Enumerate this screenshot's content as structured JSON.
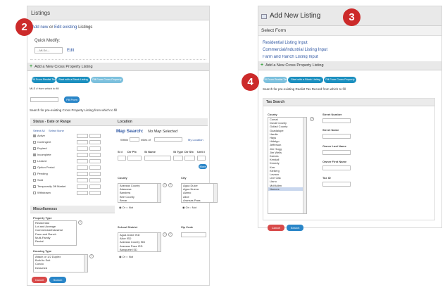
{
  "left": {
    "header": "Listings",
    "add_new": "Add new",
    "or": "or",
    "edit_existing": "Edit existing",
    "listings": "Listings",
    "quick_modify": "Quick Modify:",
    "quick_modify_placeholder": "---MLS#---",
    "edit_link": "Edit",
    "cross_title": "Add a New Cross Property Listing",
    "tabs": [
      "Fill From Realist Tax",
      "Start with a Blank Listing",
      "Fill From Cross Property"
    ],
    "mls_label": "MLS # from which to fill",
    "fill_button": "Fill From",
    "search_label": "Search for pre-existing Cross Property Listing from which to fill",
    "status_section": "Status - Date or Range",
    "select_all": "Select All",
    "select_none": "Select None",
    "statuses": [
      "Active",
      "Contingent",
      "Expired",
      "Incomplete",
      "Leased",
      "Option Period",
      "Pending",
      "Sold",
      "Temporarily Off Market",
      "Withdrawn"
    ],
    "location_section": "Location",
    "map_search": "Map Search:",
    "no_map": "No Map Selected",
    "within": "Within",
    "miles_of": "miles of",
    "my_location": "My Location",
    "addr_labels": [
      "St #",
      "Dir Pfx",
      "St Name",
      "St Type",
      "Dir Sfx",
      "Unit #"
    ],
    "more_button": "More",
    "county_label": "County",
    "counties": [
      "Aransas County",
      "Atascosa",
      "Bandera",
      "Bee County",
      "Bexar"
    ],
    "city_label": "City",
    "cities": [
      "Agua Dulce",
      "Agua Nueva",
      "Alamo",
      "Alice",
      "Aransas Pass"
    ],
    "or_opt": "Or",
    "not_opt": "Not",
    "misc_section": "Miscellaneous",
    "prop_type_label": "Property Type",
    "prop_types": [
      "Residential",
      "Lot and Acreage",
      "Commercial/Industrial",
      "Farm and Ranch",
      "Multi-Family",
      "Rental"
    ],
    "school_label": "School District",
    "schools": [
      "Agua Dulce ISD",
      "Alice ISD",
      "Aransas County ISD",
      "Aransas Pass ISD",
      "Banquete ISD"
    ],
    "zip_label": "Zip Code",
    "housing_label": "Housing Type",
    "housing": [
      "Attach or 1/2 Duplex",
      "Build to Suit",
      "Condo",
      "Detached"
    ],
    "cancel_button": "Cancel",
    "search_button": "Search"
  },
  "right": {
    "title": "Add New Listing",
    "select_form": "Select Form",
    "forms": [
      "Residential Listing Input",
      "Commercial/Industrial Listing Input",
      "Farm and Ranch Listing Input"
    ],
    "cross_title": "Add a New Cross Property Listing",
    "tabs": [
      "Fill From Realist Tax",
      "Start with a Blank Listing",
      "Fill From Cross Property"
    ],
    "search_label": "Search for pre-existing Realist Tax Record from which to fill",
    "tax_section": "Tax Search",
    "county_label": "County",
    "counties": [
      "Comal",
      "Duval County",
      "Goliad County",
      "Guadalupe",
      "Hardin",
      "Hays",
      "Hidalgo",
      "Jefferson",
      "Jim Hogg",
      "Jim Wells",
      "Karnes",
      "Kendall",
      "Kenedy",
      "Kerr",
      "Kleberg",
      "Lavaca",
      "Live Oak",
      "Llano",
      "McMullen",
      "Nueces"
    ],
    "street_number": "Street Number",
    "street_name": "Street Name",
    "owner_last": "Owner Last Name",
    "owner_first": "Owner First Name",
    "tax_id": "Tax ID",
    "cancel_button": "Cancel",
    "search_button": "Search"
  },
  "badges": [
    "2",
    "3",
    "4"
  ]
}
